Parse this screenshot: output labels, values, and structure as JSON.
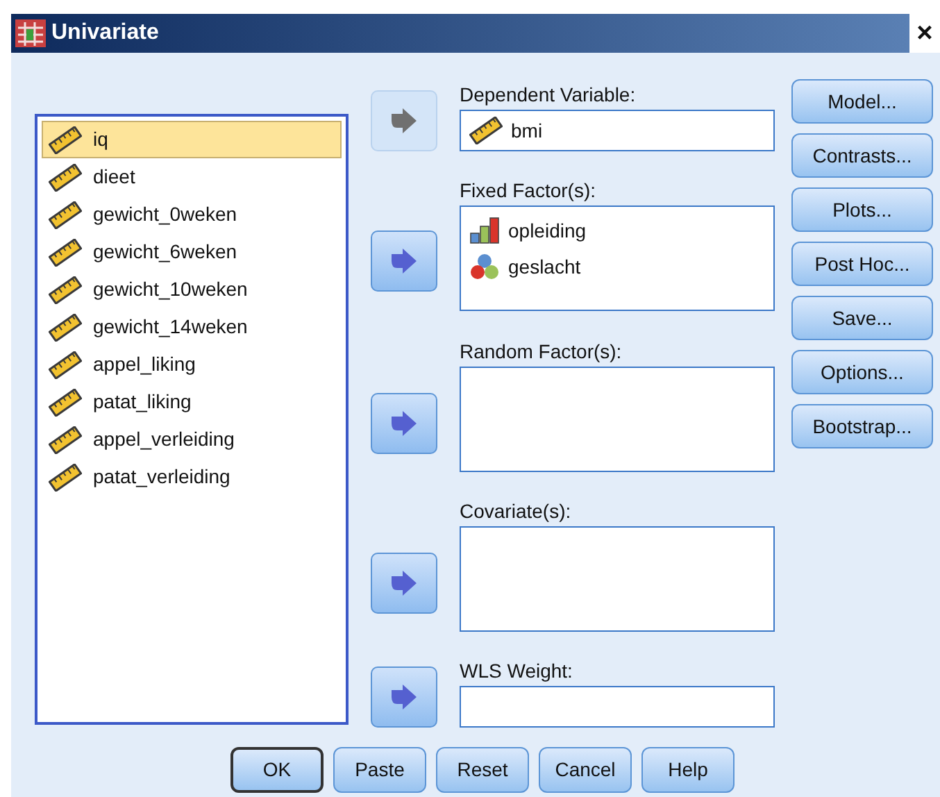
{
  "window": {
    "title": "Univariate",
    "close": "×"
  },
  "variables": [
    {
      "name": "iq",
      "kind": "scale",
      "selected": true
    },
    {
      "name": "dieet",
      "kind": "scale",
      "selected": false
    },
    {
      "name": "gewicht_0weken",
      "kind": "scale",
      "selected": false
    },
    {
      "name": "gewicht_6weken",
      "kind": "scale",
      "selected": false
    },
    {
      "name": "gewicht_10weken",
      "kind": "scale",
      "selected": false
    },
    {
      "name": "gewicht_14weken",
      "kind": "scale",
      "selected": false
    },
    {
      "name": "appel_liking",
      "kind": "scale",
      "selected": false
    },
    {
      "name": "patat_liking",
      "kind": "scale",
      "selected": false
    },
    {
      "name": "appel_verleiding",
      "kind": "scale",
      "selected": false
    },
    {
      "name": "patat_verleiding",
      "kind": "scale",
      "selected": false
    }
  ],
  "targets": [
    {
      "label": "Dependent Variable:",
      "kind": "field",
      "arrow_disabled": true,
      "items": [
        {
          "name": "bmi",
          "kind": "scale"
        }
      ]
    },
    {
      "label": "Fixed Factor(s):",
      "kind": "list",
      "arrow_disabled": false,
      "items": [
        {
          "name": "opleiding",
          "kind": "ordinal"
        },
        {
          "name": "geslacht",
          "kind": "nominal"
        }
      ]
    },
    {
      "label": "Random Factor(s):",
      "kind": "list",
      "arrow_disabled": false
    },
    {
      "label": "Covariate(s):",
      "kind": "list",
      "arrow_disabled": false
    },
    {
      "label": "WLS Weight:",
      "kind": "field",
      "arrow_disabled": false
    }
  ],
  "side_buttons": [
    "Model...",
    "Contrasts...",
    "Plots...",
    "Post Hoc...",
    "Save...",
    "Options...",
    "Bootstrap..."
  ],
  "bottom_buttons": [
    {
      "label": "OK",
      "default": true
    },
    {
      "label": "Paste",
      "default": false
    },
    {
      "label": "Reset",
      "default": false
    },
    {
      "label": "Cancel",
      "default": false
    },
    {
      "label": "Help",
      "default": false
    }
  ]
}
